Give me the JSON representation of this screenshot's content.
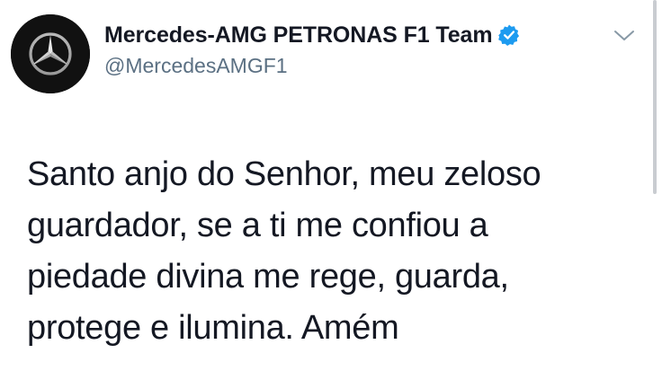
{
  "tweet": {
    "display_name": "Mercedes-AMG PETRONAS F1 Team",
    "handle": "@MercedesAMGF1",
    "verified": true,
    "text": "Santo anjo do Senhor, meu zeloso\nguardador, se a ti me confiou a\npiedade divina me rege, guarda,\nprotege e ilumina. Amém"
  },
  "icons": {
    "avatar": "mercedes-star-logo",
    "verified": "verified-badge-icon",
    "menu": "chevron-down-icon"
  },
  "colors": {
    "text": "#141823",
    "handle": "#5b7083",
    "verified_badge": "#1d9bf0",
    "avatar_background": "#111111"
  }
}
